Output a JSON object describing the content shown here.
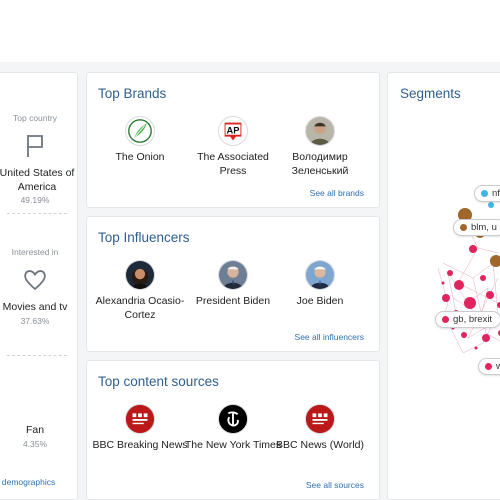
{
  "demographics": {
    "country": {
      "label": "Top country",
      "value": "United States of America",
      "percent": "49.19%",
      "icon": "flag-icon"
    },
    "interest": {
      "label": "Interested in",
      "value": "Movies and tv",
      "percent": "37.63%",
      "icon": "heart-icon"
    },
    "type": {
      "value": "Fan",
      "percent": "4.35%"
    },
    "see_all": "all demographics"
  },
  "brands": {
    "title": "Top Brands",
    "items": [
      {
        "name": "The Onion",
        "icon": "onion-logo-icon"
      },
      {
        "name": "The Associated Press",
        "icon": "ap-logo-icon"
      },
      {
        "name": "Володимир Зеленський",
        "icon": "avatar-photo-icon"
      }
    ],
    "see_all": "See all brands"
  },
  "influencers": {
    "title": "Top Influencers",
    "items": [
      {
        "name": "Alexandria Ocasio-Cortez",
        "icon": "avatar-photo-icon"
      },
      {
        "name": "President Biden",
        "icon": "avatar-photo-icon"
      },
      {
        "name": "Joe Biden",
        "icon": "avatar-photo-icon"
      }
    ],
    "see_all": "See all influencers"
  },
  "sources": {
    "title": "Top content sources",
    "items": [
      {
        "name": "BBC Breaking News",
        "icon": "bbc-news-logo-icon"
      },
      {
        "name": "The New York Times",
        "icon": "nyt-logo-icon"
      },
      {
        "name": "BBC News (World)",
        "icon": "bbc-news-logo-icon"
      }
    ],
    "see_all": "See all sources"
  },
  "segments": {
    "title": "Segments",
    "pills": [
      {
        "label": "nf",
        "color": "#3fb6e8"
      },
      {
        "label": "blm, u",
        "color": "#a0662a"
      },
      {
        "label": "gb, brexit",
        "color": "#e0245e"
      },
      {
        "label": "w",
        "color": "#e0245e"
      }
    ]
  },
  "colors": {
    "title_blue": "#2f5f8f",
    "link_blue": "#2f6fb0",
    "accent_pink": "#e0245e",
    "accent_brown": "#a0662a",
    "accent_cyan": "#3fb6e8"
  }
}
